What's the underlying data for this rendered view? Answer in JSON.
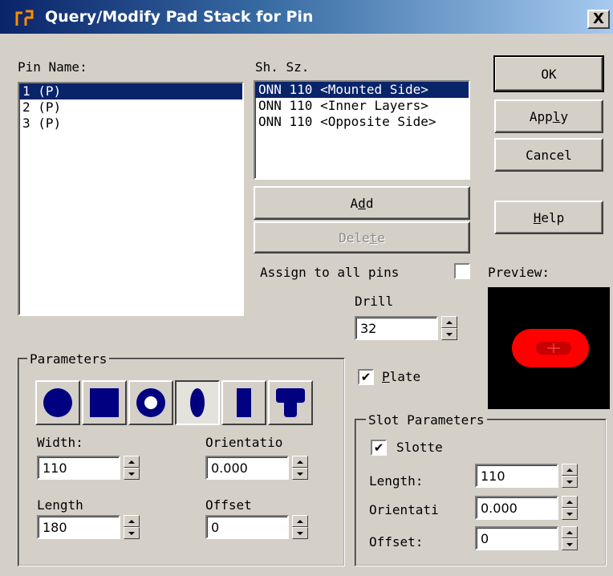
{
  "window": {
    "title": "Query/Modify Pad Stack for Pin",
    "close_label": "X"
  },
  "pin_list": {
    "label": "Pin Name:",
    "items": [
      "1 (P)",
      "2 (P)",
      "3 (P)"
    ],
    "selected_index": 0
  },
  "shape_size": {
    "label": "Sh. Sz.",
    "items": [
      "ONN 110 <Mounted Side>",
      "ONN 110 <Inner Layers>",
      "ONN 110 <Opposite Side>"
    ],
    "selected_index": 0
  },
  "buttons": {
    "ok": "OK",
    "apply": "Apply",
    "cancel": "Cancel",
    "help": "Help",
    "add": "Add",
    "delete": "Delete"
  },
  "assign_all_pins": {
    "label": "Assign to all pins",
    "checked": false
  },
  "preview": {
    "label": "Preview:"
  },
  "drill": {
    "label": "Drill",
    "value": "32"
  },
  "plated": {
    "label": "Plate",
    "checked": true
  },
  "parameters": {
    "title": "Parameters",
    "shapes": [
      "round-pad",
      "square-pad",
      "annular-pad",
      "oval-pad",
      "rectangle-pad",
      "odd-shape-pad"
    ],
    "selected_shape_index": 3,
    "width": {
      "label": "Width:",
      "value": "110"
    },
    "orientation": {
      "label": "Orientatio",
      "value": "0.000"
    },
    "length": {
      "label": "Length",
      "value": "180"
    },
    "offset": {
      "label": "Offset",
      "value": "0"
    }
  },
  "slot_parameters": {
    "title": "Slot Parameters",
    "slotted": {
      "label": "Slotte",
      "checked": true
    },
    "length": {
      "label": "Length:",
      "value": "110"
    },
    "orientation": {
      "label": "Orientati",
      "value": "0.000"
    },
    "offset": {
      "label": "Offset:",
      "value": "0"
    }
  },
  "colors": {
    "title_start": "#0a246a",
    "selection": "#0a246a",
    "shape_fill": "#000080",
    "preview_pad": "#ff0000",
    "preview_drill": "#c00000",
    "preview_bg": "#000000"
  }
}
